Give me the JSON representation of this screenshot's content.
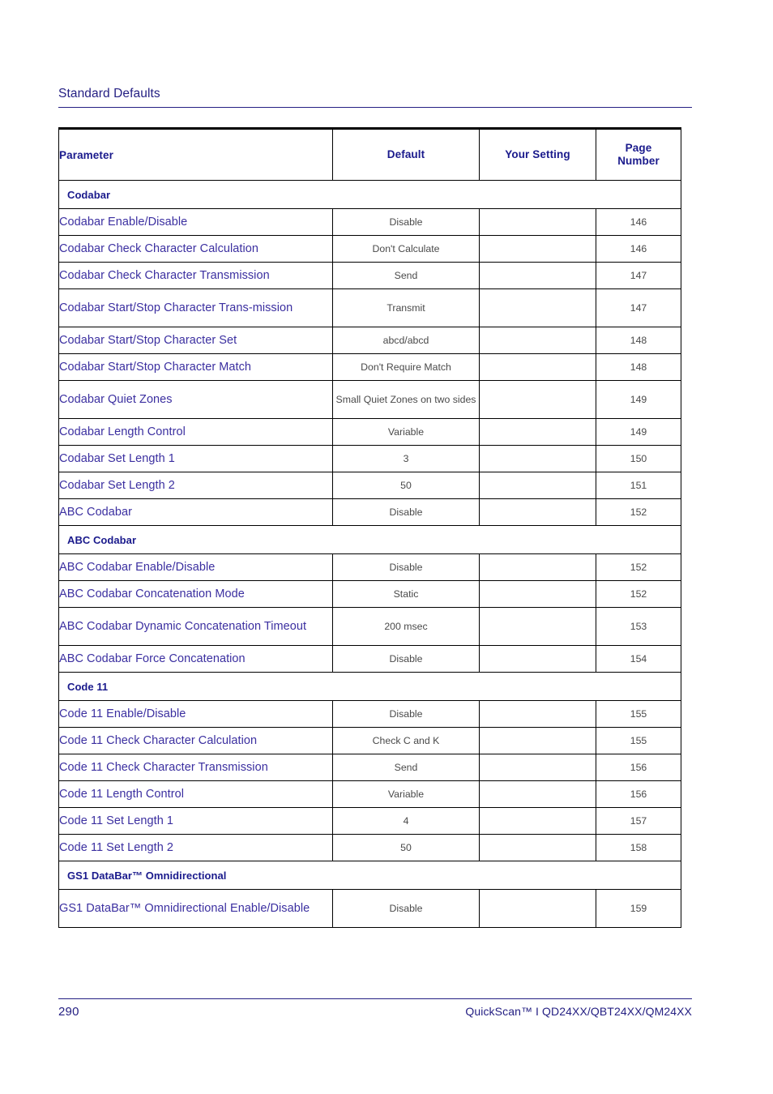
{
  "running_head": {
    "title": "Standard Defaults"
  },
  "table": {
    "columns": [
      "Parameter",
      "Default",
      "Your Setting",
      "Page Number"
    ],
    "headers": {
      "parameter": "Parameter",
      "default": "Default",
      "your_setting": "Your Setting",
      "page_number_line1": "Page",
      "page_number_line2": "Number"
    },
    "rows": [
      {
        "kind": "section",
        "parameter": "Codabar"
      },
      {
        "kind": "data",
        "parameter": "Codabar Enable/Disable",
        "default": "Disable",
        "your_setting": "",
        "page": "146"
      },
      {
        "kind": "data",
        "parameter": "Codabar Check Character Calculation",
        "default": "Don't Calculate",
        "your_setting": "",
        "page": "146"
      },
      {
        "kind": "data",
        "parameter": "Codabar Check Character Transmission",
        "default": "Send",
        "your_setting": "",
        "page": "147"
      },
      {
        "kind": "data",
        "tall": true,
        "parameter": "Codabar Start/Stop Character Trans-mission",
        "default": "Transmit",
        "your_setting": "",
        "page": "147"
      },
      {
        "kind": "data",
        "parameter": "Codabar Start/Stop Character Set",
        "default": "abcd/abcd",
        "your_setting": "",
        "page": "148"
      },
      {
        "kind": "data",
        "parameter": "Codabar Start/Stop Character Match",
        "default": "Don't Require Match",
        "your_setting": "",
        "page": "148"
      },
      {
        "kind": "data",
        "tall": true,
        "parameter": "Codabar Quiet Zones",
        "default": "Small Quiet Zones on two sides",
        "your_setting": "",
        "page": "149"
      },
      {
        "kind": "data",
        "parameter": "Codabar Length Control",
        "default": "Variable",
        "your_setting": "",
        "page": "149"
      },
      {
        "kind": "data",
        "parameter": "Codabar Set Length 1",
        "default": "3",
        "your_setting": "",
        "page": "150"
      },
      {
        "kind": "data",
        "parameter": "Codabar Set Length 2",
        "default": "50",
        "your_setting": "",
        "page": "151"
      },
      {
        "kind": "data",
        "parameter": "ABC Codabar",
        "default": "Disable",
        "your_setting": "",
        "page": "152"
      },
      {
        "kind": "section",
        "parameter": "ABC Codabar"
      },
      {
        "kind": "data",
        "parameter": "ABC Codabar Enable/Disable",
        "default": "Disable",
        "your_setting": "",
        "page": "152"
      },
      {
        "kind": "data",
        "parameter": "ABC Codabar Concatenation Mode",
        "default": "Static",
        "your_setting": "",
        "page": "152"
      },
      {
        "kind": "data",
        "tall": true,
        "parameter": "ABC Codabar Dynamic Concatenation Timeout",
        "default": "200 msec",
        "your_setting": "",
        "page": "153"
      },
      {
        "kind": "data",
        "parameter": "ABC Codabar Force Concatenation",
        "default": "Disable",
        "your_setting": "",
        "page": "154"
      },
      {
        "kind": "section",
        "parameter": "Code 11"
      },
      {
        "kind": "data",
        "parameter": "Code 11 Enable/Disable",
        "default": "Disable",
        "your_setting": "",
        "page": "155"
      },
      {
        "kind": "data",
        "parameter": "Code 11 Check Character Calculation",
        "default": "Check C and K",
        "your_setting": "",
        "page": "155"
      },
      {
        "kind": "data",
        "parameter": "Code 11 Check Character Transmission",
        "default": "Send",
        "your_setting": "",
        "page": "156"
      },
      {
        "kind": "data",
        "parameter": "Code 11 Length Control",
        "default": "Variable",
        "your_setting": "",
        "page": "156"
      },
      {
        "kind": "data",
        "parameter": "Code 11 Set Length 1",
        "default": "4",
        "your_setting": "",
        "page": "157"
      },
      {
        "kind": "data",
        "parameter": "Code 11 Set Length 2",
        "default": "50",
        "your_setting": "",
        "page": "158"
      },
      {
        "kind": "section",
        "parameter": "GS1 DataBar™ Omnidirectional"
      },
      {
        "kind": "data",
        "tall": true,
        "parameter": "GS1 DataBar™ Omnidirectional Enable/Disable",
        "default": "Disable",
        "your_setting": "",
        "page": "159"
      }
    ]
  },
  "footer": {
    "page_number": "290",
    "product": "QuickScan™ I QD24XX/QBT24XX/QM24XX"
  },
  "colors": {
    "heading_blue": "#252083",
    "header_blue": "#1a1a8c",
    "parameter_blue": "#3b2fa0",
    "value_gray": "#4a4a4a",
    "rule": "#252083",
    "border": "#000000"
  }
}
